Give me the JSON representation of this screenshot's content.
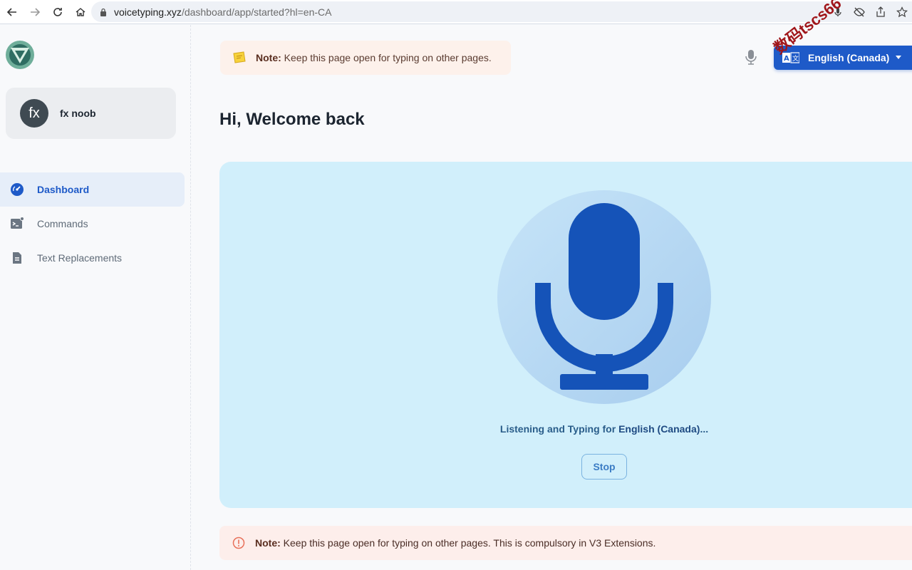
{
  "browser": {
    "url_host": "voicetyping.xyz",
    "url_path": "/dashboard/app/started?hl=en-CA"
  },
  "sidebar": {
    "user": {
      "avatar_initials": "fx",
      "name": "fx noob"
    },
    "items": [
      {
        "label": "Dashboard",
        "icon": "dashboard-gauge-icon",
        "active": true
      },
      {
        "label": "Commands",
        "icon": "terminal-icon",
        "active": false
      },
      {
        "label": "Text Replacements",
        "icon": "document-icon",
        "active": false
      }
    ]
  },
  "header": {
    "note_prefix": "Note:",
    "note_text": " Keep this page open for typing on other pages.",
    "language_button": "English (Canada)",
    "watermark": "数码tscs66"
  },
  "main": {
    "welcome": "Hi, Welcome back",
    "listening_prefix": "Listening and Typing for ",
    "listening_language": "English (Canada)",
    "listening_suffix": "...",
    "stop_label": "Stop",
    "bottom_note_prefix": "Note:",
    "bottom_note_text": " Keep this page open for typing on other pages. This is compulsory in V3 Extensions."
  },
  "colors": {
    "accent": "#1e5ac8",
    "panel_bg": "#d1effb",
    "mic": "#1553b8",
    "note_bg": "#fdf1eb"
  }
}
